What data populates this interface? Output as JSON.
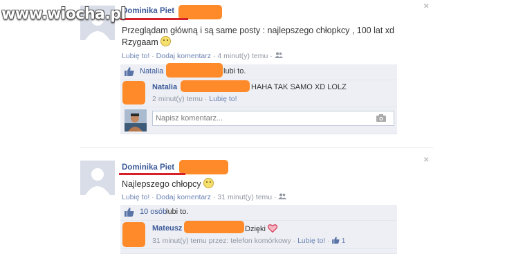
{
  "watermark": "www.wiocha.pl",
  "posts": [
    {
      "author": "Dominika Piet",
      "text_line1": "Przeglądam główną i są same posty : najlepszego chłopkcy , 100 lat xd",
      "text_line2": "Rzygaam",
      "actions": {
        "like": "Lubię to!",
        "sep1": "·",
        "comment": "Dodaj komentarz",
        "sep2": "·",
        "time": "4 minut(y) temu",
        "sep3": "·"
      },
      "likes": {
        "name": "Natalia",
        "suffix": "lubi to."
      },
      "comments": [
        {
          "name": "Natalia",
          "text": "HAHA TAK SAMO XD LOLZ",
          "time": "2 minut(y) temu",
          "sep": "·",
          "like": "Lubię to!"
        }
      ],
      "input_placeholder": "Napisz komentarz..."
    },
    {
      "author": "Dominika Piet",
      "text_line1": "Najlepszego chłopcy",
      "actions": {
        "like": "Lubię to!",
        "sep1": "·",
        "comment": "Dodaj komentarz",
        "sep2": "·",
        "time": "31 minut(y) temu",
        "sep3": "·"
      },
      "likes": {
        "count": "10 osób",
        "suffix": "lubi to."
      },
      "comments": [
        {
          "name": "Mateusz",
          "text": "Dzięki",
          "time": "31 minut(y) temu przez: telefon komórkowy",
          "sep": "·",
          "like": "Lubię to!",
          "sep2": "·",
          "like_count": "1"
        }
      ]
    }
  ],
  "icons": {
    "close": "close-icon",
    "friends": "friends-icon",
    "thumbs_up": "thumbs-up-icon",
    "camera": "camera-icon",
    "heart": "heart-icon"
  },
  "colors": {
    "link": "#3b5998",
    "meta": "#9197a3",
    "comment_bg": "#edeff4",
    "censor": "#ff8a2a",
    "underline": "#d8202a"
  }
}
